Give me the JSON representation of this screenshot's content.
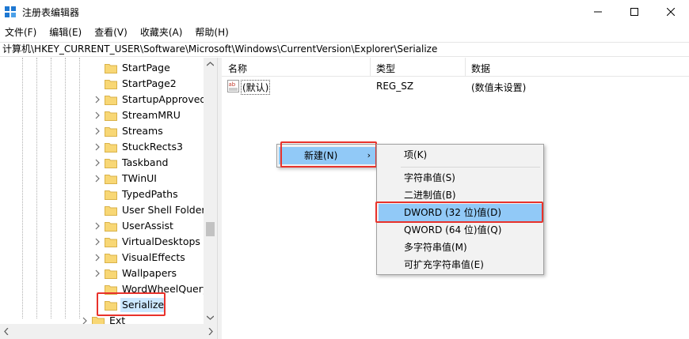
{
  "window": {
    "title": "注册表编辑器"
  },
  "menu": [
    "文件(F)",
    "编辑(E)",
    "查看(V)",
    "收藏夹(A)",
    "帮助(H)"
  ],
  "address": "计算机\\HKEY_CURRENT_USER\\Software\\Microsoft\\Windows\\CurrentVersion\\Explorer\\Serialize",
  "tree": {
    "items": [
      {
        "label": "StartPage",
        "expandable": false
      },
      {
        "label": "StartPage2",
        "expandable": false
      },
      {
        "label": "StartupApproved",
        "expandable": true
      },
      {
        "label": "StreamMRU",
        "expandable": true
      },
      {
        "label": "Streams",
        "expandable": true
      },
      {
        "label": "StuckRects3",
        "expandable": true
      },
      {
        "label": "Taskband",
        "expandable": true
      },
      {
        "label": "TWinUI",
        "expandable": true
      },
      {
        "label": "TypedPaths",
        "expandable": false
      },
      {
        "label": "User Shell Folders",
        "expandable": false
      },
      {
        "label": "UserAssist",
        "expandable": true
      },
      {
        "label": "VirtualDesktops",
        "expandable": true
      },
      {
        "label": "VisualEffects",
        "expandable": true
      },
      {
        "label": "Wallpapers",
        "expandable": true
      },
      {
        "label": "WordWheelQuery",
        "expandable": false
      },
      {
        "label": "Serialize",
        "expandable": false,
        "selected": true
      }
    ],
    "parent_item": {
      "label": "Ext",
      "expandable": true
    }
  },
  "list": {
    "columns": [
      "名称",
      "类型",
      "数据"
    ],
    "rows": [
      {
        "name": "(默认)",
        "type": "REG_SZ",
        "data": "(数值未设置)"
      }
    ]
  },
  "context_menu": {
    "new_label": "新建(N)",
    "submenu": [
      "项(K)",
      "字符串值(S)",
      "二进制值(B)",
      "DWORD (32 位)值(D)",
      "QWORD (64 位)值(Q)",
      "多字符串值(M)",
      "可扩充字符串值(E)"
    ]
  },
  "colors": {
    "selection": "#cce8ff",
    "menu_hover": "#91c9f7",
    "highlight_box": "#e8322b",
    "folder": "#f8d775"
  }
}
